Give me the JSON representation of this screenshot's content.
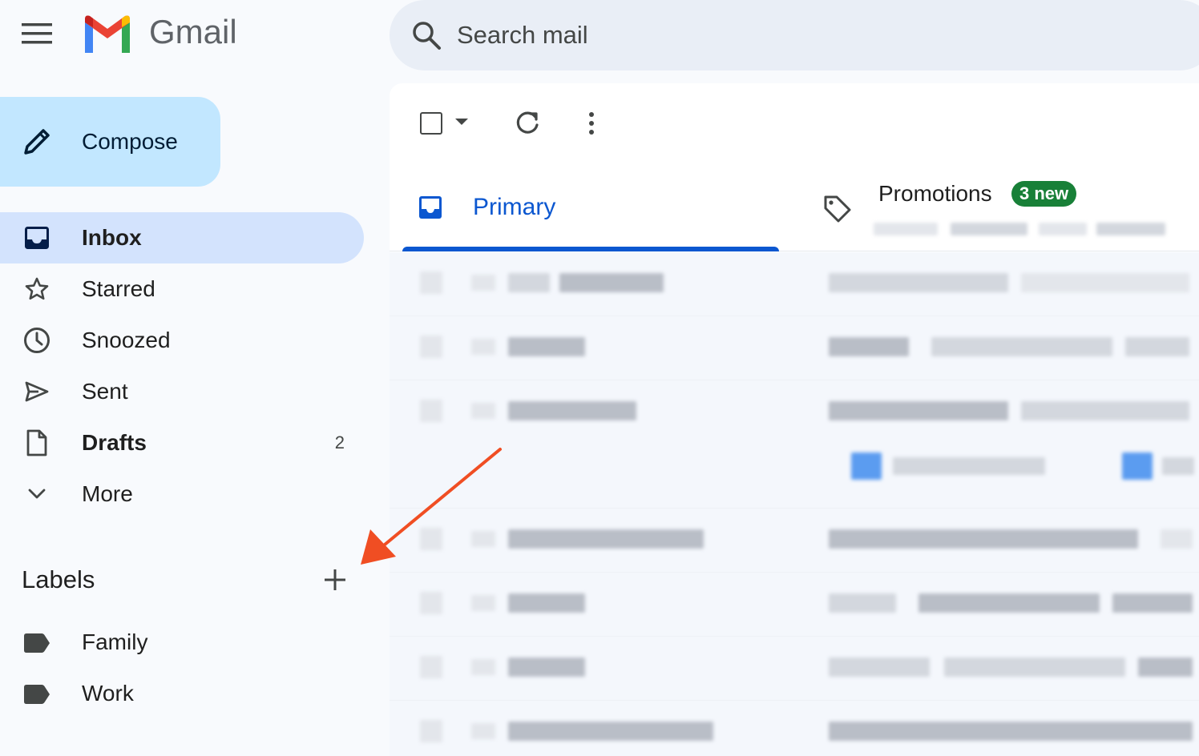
{
  "app": {
    "logo_text": "Gmail",
    "brand_colors": {
      "red": "#ea4335",
      "blue": "#4285f4",
      "green": "#34a853",
      "yellow": "#fbbc04"
    }
  },
  "search": {
    "placeholder": "Search mail",
    "icon": "search-icon"
  },
  "compose": {
    "label": "Compose",
    "icon": "pencil-icon"
  },
  "nav": {
    "items": [
      {
        "label": "Inbox",
        "icon": "inbox-icon",
        "active": true
      },
      {
        "label": "Starred",
        "icon": "star-icon"
      },
      {
        "label": "Snoozed",
        "icon": "clock-icon"
      },
      {
        "label": "Sent",
        "icon": "send-icon"
      },
      {
        "label": "Drafts",
        "icon": "draft-icon",
        "count": "2"
      },
      {
        "label": "More",
        "icon": "chevron-down-icon"
      }
    ]
  },
  "labels": {
    "heading": "Labels",
    "add_icon": "plus-icon",
    "items": [
      {
        "label": "Family",
        "icon": "label-icon"
      },
      {
        "label": "Work",
        "icon": "label-icon"
      }
    ]
  },
  "tabs": {
    "primary": {
      "label": "Primary",
      "icon": "inbox-icon"
    },
    "promotions": {
      "label": "Promotions",
      "badge": "3 new",
      "icon": "tag-icon"
    }
  },
  "colors": {
    "accent": "#0b57d0",
    "compose_bg": "#c2e7ff",
    "active_nav_bg": "#d3e3fd",
    "badge_green": "#188038",
    "annotation_arrow": "#f04e23"
  }
}
